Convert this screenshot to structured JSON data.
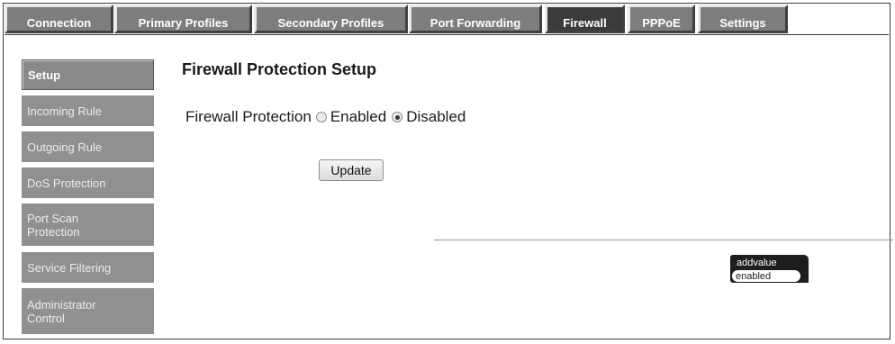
{
  "tabs": [
    {
      "label": "Connection",
      "active": false
    },
    {
      "label": "Primary Profiles",
      "active": false
    },
    {
      "label": "Secondary Profiles",
      "active": false
    },
    {
      "label": "Port Forwarding",
      "active": false
    },
    {
      "label": "Firewall",
      "active": true
    },
    {
      "label": "PPPoE",
      "active": false
    },
    {
      "label": "Settings",
      "active": false
    }
  ],
  "sidebar": {
    "items": [
      {
        "label": "Setup",
        "active": true
      },
      {
        "label": "Incoming Rule",
        "active": false
      },
      {
        "label": "Outgoing Rule",
        "active": false
      },
      {
        "label": "DoS Protection",
        "active": false
      },
      {
        "label": "Port Scan Protection",
        "active": false
      },
      {
        "label": "Service Filtering",
        "active": false
      },
      {
        "label": "Administrator Control",
        "active": false
      }
    ]
  },
  "main": {
    "title": "Firewall Protection Setup",
    "firewall": {
      "label": "Firewall Protection",
      "options": [
        {
          "label": "Enabled",
          "checked": false
        },
        {
          "label": "Disabled",
          "checked": true
        }
      ]
    },
    "update_label": "Update"
  },
  "logo": {
    "line1": "addvalue",
    "line2": "enabled"
  },
  "colors": {
    "tab_bg": "#7d7d7d",
    "tab_active_bg": "#3b3b3b",
    "sidebar_bg": "#909090",
    "logo_dark": "#1e1e1e"
  }
}
